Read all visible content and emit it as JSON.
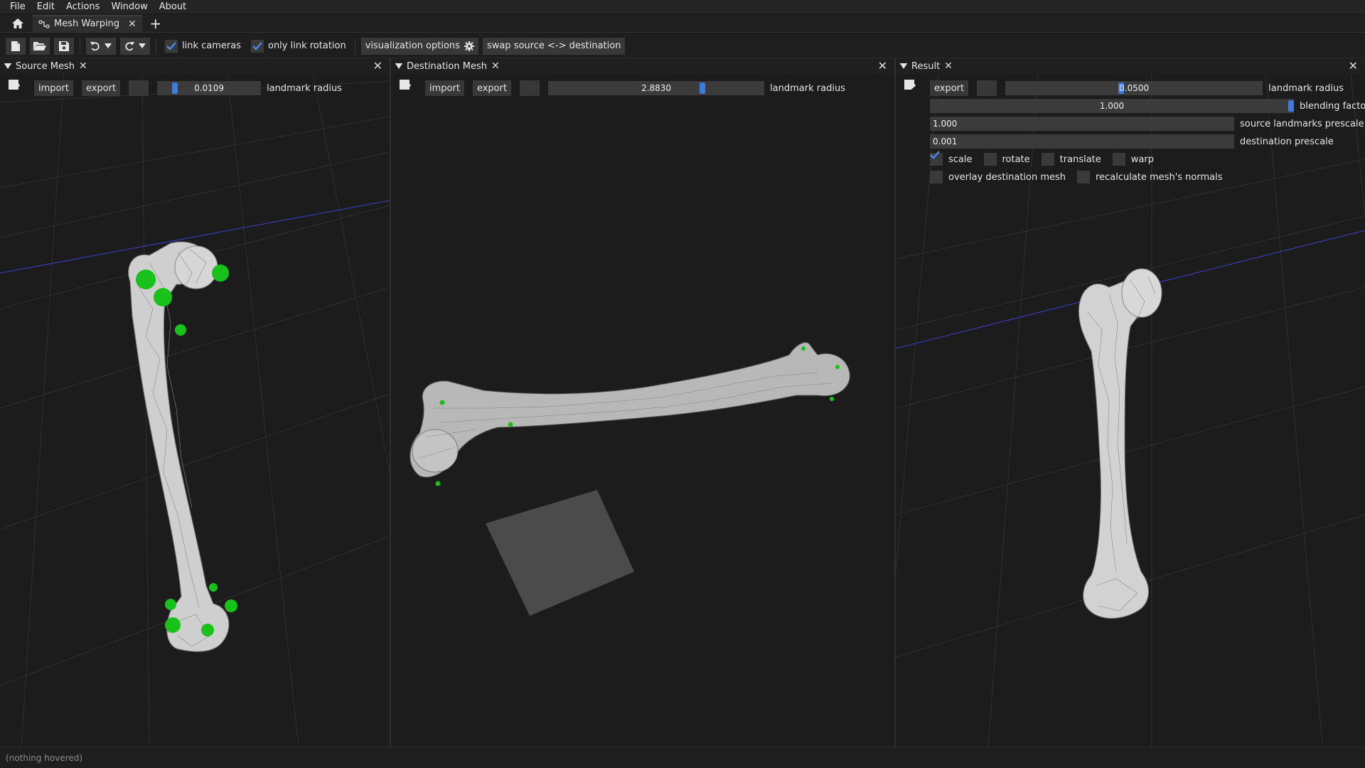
{
  "menu": [
    "File",
    "Edit",
    "Actions",
    "Window",
    "About"
  ],
  "tabs": [
    {
      "label": "Mesh Warping"
    }
  ],
  "toolbar": {
    "link_cameras": {
      "label": "link cameras",
      "checked": true
    },
    "only_link_rotation": {
      "label": "only link rotation",
      "checked": true
    },
    "visualization_options": "visualization options",
    "swap": "swap source <-> destination"
  },
  "panels": {
    "source": {
      "title": "Source Mesh",
      "import_label": "import",
      "export_label": "export",
      "landmark_radius": {
        "value": "0.0109",
        "label": "landmark radius",
        "fraction": 0.15
      }
    },
    "destination": {
      "title": "Destination Mesh",
      "import_label": "import",
      "export_label": "export",
      "landmark_radius": {
        "value": "2.8830",
        "label": "landmark radius",
        "fraction": 0.72
      }
    },
    "result": {
      "title": "Result",
      "export_label": "export",
      "landmark_radius": {
        "value": "0.0500",
        "label": "landmark radius",
        "fraction": 0.45
      },
      "blending_factor": {
        "value": "1.000",
        "label": "blending factor",
        "fraction": 1.0
      },
      "source_landmarks_prescale": {
        "value": "1.000",
        "label": "source landmarks prescale"
      },
      "destination_prescale": {
        "value": "0.001",
        "label": "destination prescale"
      },
      "options": {
        "scale": {
          "label": "scale",
          "checked": true
        },
        "rotate": {
          "label": "rotate",
          "checked": false
        },
        "translate": {
          "label": "translate",
          "checked": false
        },
        "warp": {
          "label": "warp",
          "checked": true
        },
        "overlay_destination_mesh": {
          "label": "overlay destination mesh",
          "checked": false
        },
        "recalculate_normals": {
          "label": "recalculate mesh's normals",
          "checked": false
        }
      }
    }
  },
  "status": "(nothing hovered)",
  "colors": {
    "accent": "#3d7bdc",
    "landmark": "#19c21a",
    "background": "#1c1c1c"
  }
}
